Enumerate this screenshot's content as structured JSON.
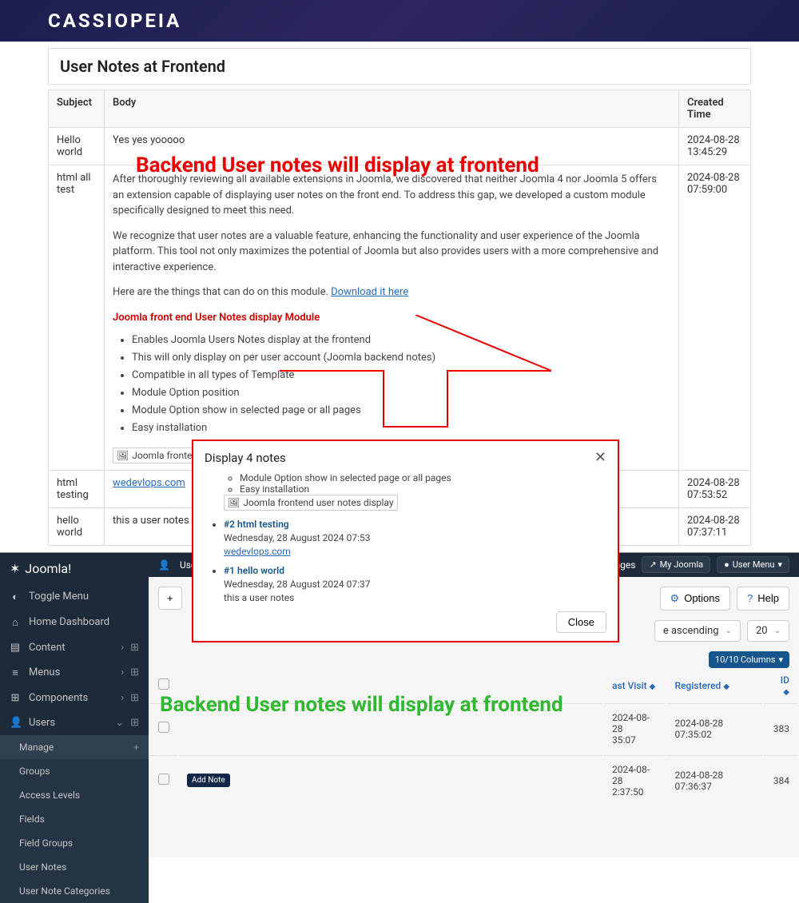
{
  "frontend": {
    "logo": "CASSIOPEIA",
    "page_title": "User Notes at Frontend",
    "columns": {
      "subject": "Subject",
      "body": "Body",
      "created": "Created Time"
    },
    "rows": [
      {
        "subject": "Hello world",
        "body_text": "Yes yes yooooo",
        "created": "2024-08-28 13:45:29"
      },
      {
        "subject": "html all test",
        "body_p1": "After thoroughly reviewing all available extensions in Joomla, we discovered that neither Joomla 4 nor Joomla 5 offers an extension capable of displaying user notes on the front end. To address this gap, we developed a custom module specifically designed to meet this need.",
        "body_p2": "We recognize that user notes are a valuable feature, enhancing the functionality and user experience of the Joomla platform. This tool not only maximizes the potential of Joomla but also provides users with a more comprehensive and interactive experience.",
        "body_p3_prefix": "Here are the things that can do on this module.  ",
        "body_p3_link": "Download it here",
        "body_heading": "Joomla front end User Notes display Module",
        "bullets": [
          "Enables Joomla Users Notes display at the frontend",
          "This will only display on per user account (Joomla backend notes)",
          "Compatible in all types of Template",
          "Module Option position",
          "Module Option show in selected page or all pages",
          "Easy installation"
        ],
        "img_alt": "Joomla frontend user notes display",
        "created": "2024-08-28 07:59:00"
      },
      {
        "subject": "html testing",
        "body_link": "wedevlops.com",
        "created": "2024-08-28 07:53:52"
      },
      {
        "subject": "hello world",
        "body_text": "this a user notes",
        "created": "2024-08-28 07:37:11"
      }
    ]
  },
  "annotation_red": "Backend User notes will display at frontend",
  "annotation_green": "Backend User notes will display at frontend",
  "backend": {
    "logo": "Joomla!",
    "topbar": {
      "users_label": "Use",
      "messages": "essages",
      "my_joomla": "My Joomla",
      "user_menu": "User Menu"
    },
    "sidebar": {
      "toggle": "Toggle Menu",
      "items": [
        {
          "label": "Home Dashboard",
          "icon": "⌂"
        },
        {
          "label": "Content",
          "icon": "▤",
          "expandable": true
        },
        {
          "label": "Menus",
          "icon": "≡",
          "expandable": true
        },
        {
          "label": "Components",
          "icon": "⊞",
          "expandable": true
        },
        {
          "label": "Users",
          "icon": "👤",
          "expanded": true
        }
      ],
      "sub": [
        {
          "label": "Manage",
          "active": true,
          "plus": true
        },
        {
          "label": "Groups"
        },
        {
          "label": "Access Levels"
        },
        {
          "label": "Fields"
        },
        {
          "label": "Field Groups"
        },
        {
          "label": "User Notes"
        },
        {
          "label": "User Note Categories"
        }
      ]
    },
    "toolbar": {
      "new": "+",
      "options": "Options",
      "help": "Help"
    },
    "filters": {
      "sort": "e ascending",
      "per_page": "20",
      "columns": "10/10 Columns"
    },
    "table": {
      "headers": {
        "last_visit": "ast Visit",
        "registered": "Registered",
        "id": "ID"
      },
      "rows": [
        {
          "last_visit": "2024-08-28",
          "last_visit_time": "35:07",
          "registered": "2024-08-28 07:35:02",
          "id": "383"
        },
        {
          "last_visit": "2024-08-28",
          "last_visit_time": "2:37:50",
          "registered": "2024-08-28 07:36:37",
          "id": "384"
        }
      ]
    },
    "add_note": "Add Note"
  },
  "modal": {
    "title": "Display 4 notes",
    "bullets_top": [
      "Module Option show in selected page or all pages",
      "Easy installation"
    ],
    "img_alt": "Joomla frontend user notes display",
    "notes": [
      {
        "title": "#2 html testing",
        "date": "Wednesday, 28 August 2024 07:53",
        "link": "wedevlops.com"
      },
      {
        "title": "#1 hello world",
        "date": "Wednesday, 28 August 2024 07:37",
        "text": "this a user notes"
      }
    ],
    "close": "Close"
  }
}
